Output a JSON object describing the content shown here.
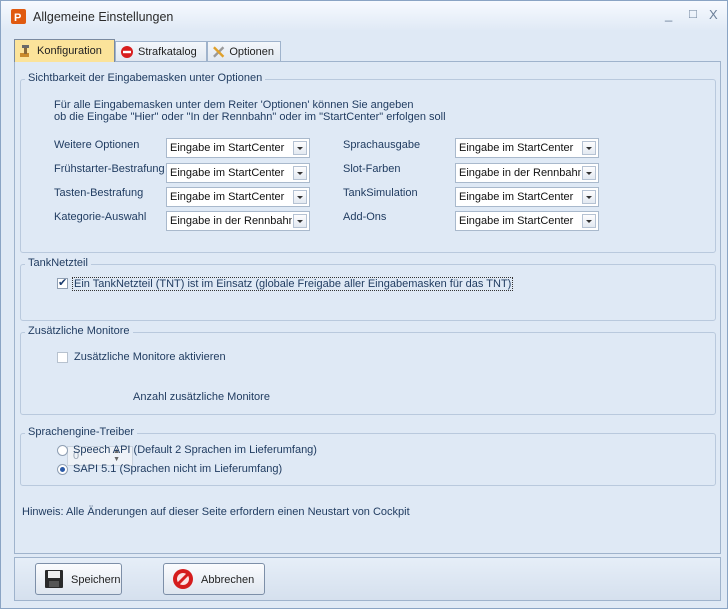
{
  "window": {
    "title": "Allgemeine Einstellungen"
  },
  "titlebar_buttons": {
    "minimize": "_",
    "maximize": "□",
    "close": "X"
  },
  "tabs": [
    {
      "label": "Konfiguration",
      "icon": "tools-icon",
      "active": true
    },
    {
      "label": "Strafkatalog",
      "icon": "no-entry-icon",
      "active": false
    },
    {
      "label": "Optionen",
      "icon": "wrench-screwdriver-icon",
      "active": false
    }
  ],
  "visibility": {
    "legend": "Sichtbarkeit der Eingabemasken unter Optionen",
    "desc_line1": "Für alle Eingabemasken unter dem Reiter 'Optionen' können Sie angeben",
    "desc_line2": "ob die Eingabe \"Hier\" oder \"In der Rennbahn\" oder im \"StartCenter\" erfolgen soll",
    "left": [
      {
        "label": "Weitere Optionen",
        "value": "Eingabe im StartCenter"
      },
      {
        "label": "Frühstarter-Bestrafung",
        "value": "Eingabe im StartCenter"
      },
      {
        "label": "Tasten-Bestrafung",
        "value": "Eingabe im StartCenter"
      },
      {
        "label": "Kategorie-Auswahl",
        "value": "Eingabe in der Rennbahn"
      }
    ],
    "right": [
      {
        "label": "Sprachausgabe",
        "value": "Eingabe im StartCenter"
      },
      {
        "label": "Slot-Farben",
        "value": "Eingabe in der Rennbahn"
      },
      {
        "label": "TankSimulation",
        "value": "Eingabe im StartCenter"
      },
      {
        "label": "Add-Ons",
        "value": "Eingabe im StartCenter"
      }
    ]
  },
  "tank": {
    "legend": "TankNetzteil",
    "checkbox_label": "Ein TankNetzteil (TNT) ist im Einsatz (globale Freigabe aller Eingabemasken für das TNT)",
    "checked": true
  },
  "monitors": {
    "legend": "Zusätzliche Monitore",
    "checkbox_label": "Zusätzliche Monitore aktivieren",
    "checked": false,
    "spin_value": "0",
    "spin_label": "Anzahl zusätzliche Monitore"
  },
  "speech": {
    "legend": "Sprachengine-Treiber",
    "option1": "Speech API  (Default 2 Sprachen im Lieferumfang)",
    "option2": "SAPI 5.1  (Sprachen nicht im Lieferumfang)",
    "selected": "SAPI 5.1"
  },
  "hint": "Hinweis:  Alle Änderungen auf dieser Seite erfordern einen Neustart von Cockpit",
  "footer": {
    "save_label": "Speichern",
    "cancel_label": "Abbrechen"
  },
  "colors": {
    "background": "#dfe9f5",
    "active_tab": "#fbe39a",
    "text": "#1e3a5f"
  }
}
